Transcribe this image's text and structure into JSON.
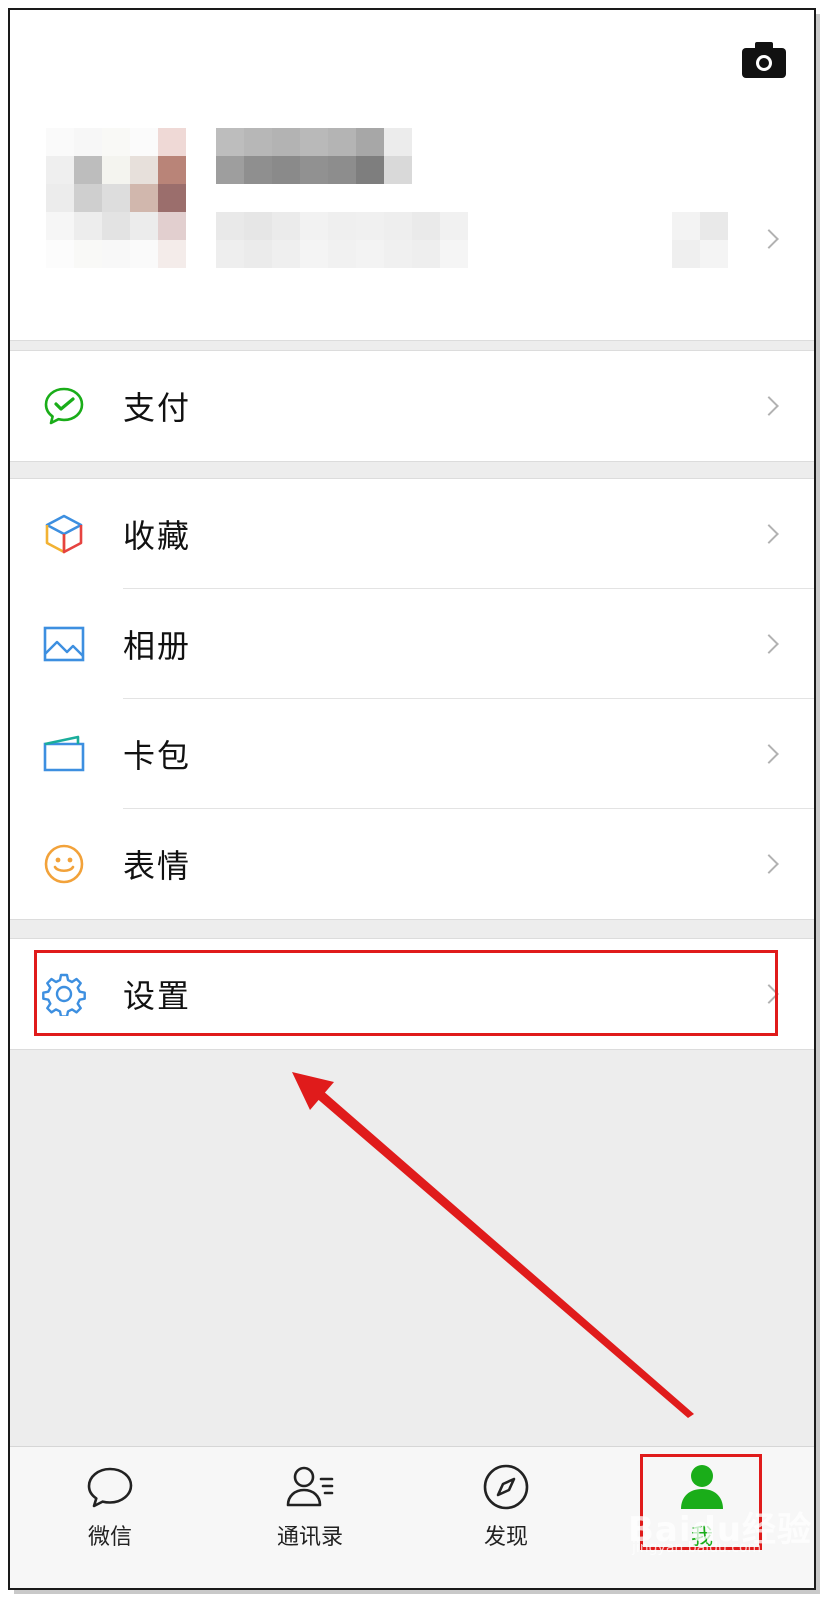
{
  "menu": {
    "pay": {
      "label": "支付",
      "icon": "wechat-pay-icon"
    },
    "favorites": {
      "label": "收藏",
      "icon": "cube-icon"
    },
    "album": {
      "label": "相册",
      "icon": "picture-icon"
    },
    "cards": {
      "label": "卡包",
      "icon": "wallet-icon"
    },
    "stickers": {
      "label": "表情",
      "icon": "smiley-icon"
    },
    "settings": {
      "label": "设置",
      "icon": "gear-icon"
    }
  },
  "tabs": [
    {
      "label": "微信",
      "icon": "chat-bubble-icon",
      "active": false
    },
    {
      "label": "通讯录",
      "icon": "contacts-icon",
      "active": false
    },
    {
      "label": "发现",
      "icon": "compass-icon",
      "active": false
    },
    {
      "label": "我",
      "icon": "person-icon",
      "active": true
    }
  ],
  "watermark": {
    "main": "Baidu经验",
    "sub": "jingyan.baidu.com"
  },
  "colors": {
    "accent_green": "#1aad19",
    "annotation_red": "#e01b1b",
    "background": "#ededed"
  }
}
